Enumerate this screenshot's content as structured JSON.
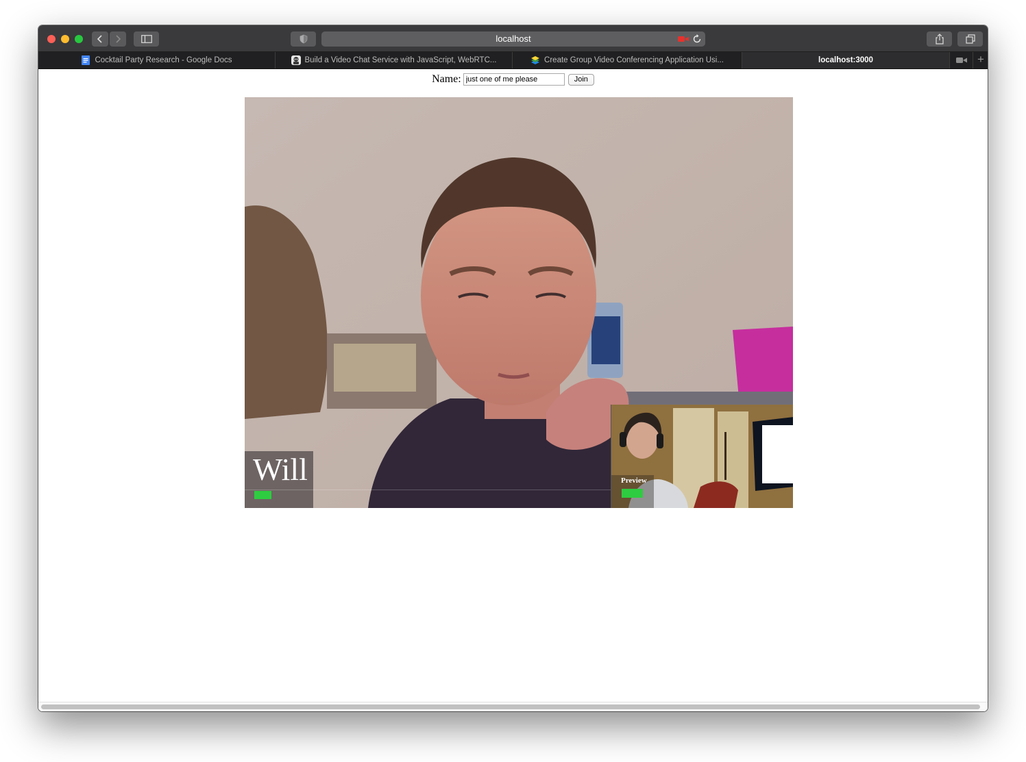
{
  "browser": {
    "address_text": "localhost",
    "tabs": [
      {
        "label": "Cocktail Party Research - Google Docs",
        "icon": "google-docs-icon",
        "active": false
      },
      {
        "label": "Build a Video Chat Service with JavaScript, WebRTC...",
        "icon": "blog-avatar-icon",
        "active": false
      },
      {
        "label": "Create Group Video Conferencing Application Usi...",
        "icon": "layers-stack-icon",
        "active": false
      },
      {
        "label": "localhost:3000",
        "icon": null,
        "active": true
      }
    ],
    "camera_in_use_color": "#e5322d",
    "toolbar_icons": [
      "back-icon",
      "forward-icon",
      "sidebar-icon",
      "privacy-shield-icon",
      "camera-recording-icon",
      "reload-icon",
      "share-icon",
      "tab-overview-icon"
    ]
  },
  "page": {
    "name_label": "Name:",
    "name_value": "just one of me please",
    "join_label": "Join",
    "remote_participant": {
      "name": "Will",
      "audio_level_color": "#2ecc40"
    },
    "preview": {
      "label": "Preview",
      "audio_level_color": "#2ecc40"
    }
  }
}
